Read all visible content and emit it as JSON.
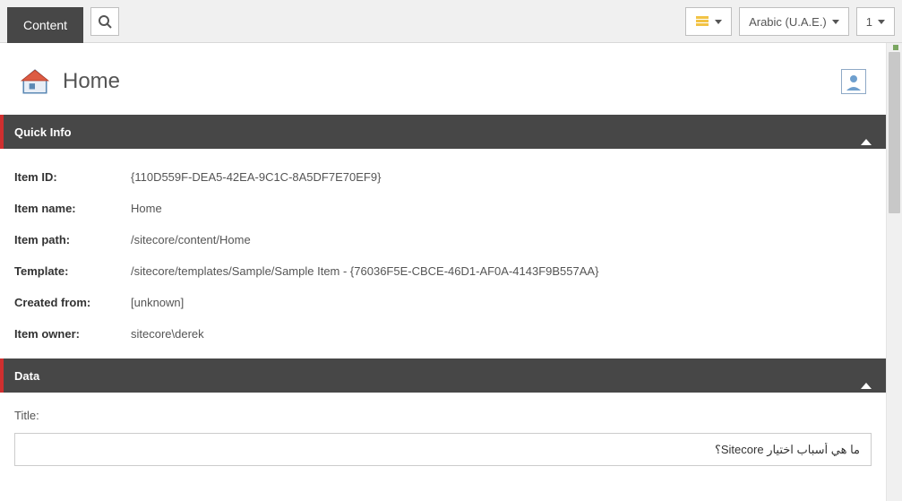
{
  "toolbar": {
    "content_tab": "Content",
    "language": "Arabic (U.A.E.)",
    "version": "1"
  },
  "header": {
    "title": "Home"
  },
  "sections": {
    "quick_info": {
      "title": "Quick Info",
      "rows": {
        "item_id_label": "Item ID:",
        "item_id_value": "{110D559F-DEA5-42EA-9C1C-8A5DF7E70EF9}",
        "item_name_label": "Item name:",
        "item_name_value": "Home",
        "item_path_label": "Item path:",
        "item_path_value": "/sitecore/content/Home",
        "template_label": "Template:",
        "template_value": "/sitecore/templates/Sample/Sample Item - {76036F5E-CBCE-46D1-AF0A-4143F9B557AA}",
        "created_from_label": "Created from:",
        "created_from_value": "[unknown]",
        "item_owner_label": "Item owner:",
        "item_owner_value": "sitecore\\derek"
      }
    },
    "data": {
      "title": "Data",
      "fields": {
        "title_label": "Title:",
        "title_value": "ما هي أسباب اختيار Sitecore؟"
      }
    }
  }
}
